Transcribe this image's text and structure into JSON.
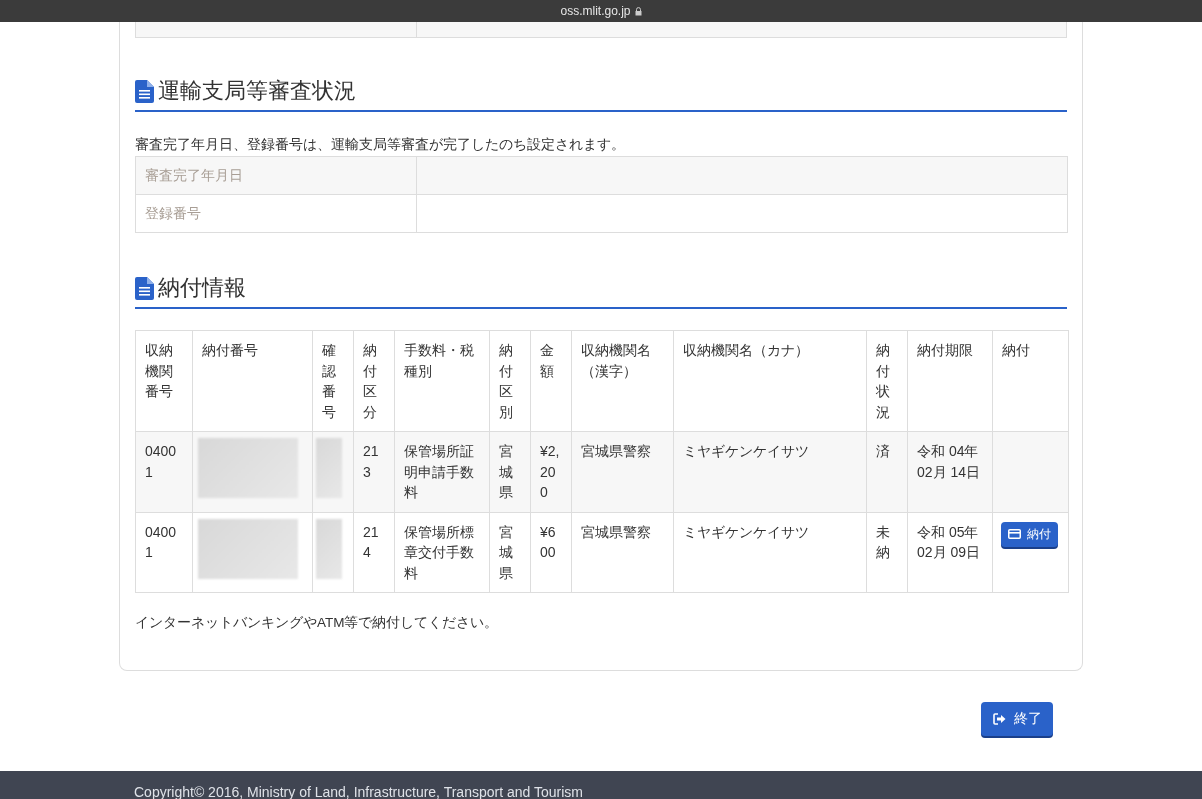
{
  "browser_bar": {
    "address": "oss.mlit.go.jp"
  },
  "review_section": {
    "title": "運輸支局等審査状況",
    "note": "審査完了年月日、登録番号は、運輸支局等審査が完了したのち設定されます。",
    "rows": [
      {
        "label": "審査完了年月日"
      },
      {
        "label": "登録番号"
      }
    ]
  },
  "payment_section": {
    "title": "納付情報",
    "columns": [
      "収納機関番号",
      "納付番号",
      "確認番号",
      "納付区分",
      "手数料・税種別",
      "納付区別",
      "金額",
      "収納機関名（漢字）",
      "収納機関名（カナ）",
      "納付状況",
      "納付期限",
      "納付"
    ],
    "rows": [
      {
        "agency_no": "04001",
        "payment_no": {
          "kind": "redacted"
        },
        "confirm_no": {
          "kind": "redacted"
        },
        "category": "213",
        "fee_type": "保管場所証明申請手数料",
        "division": "宮城県",
        "amount": "¥2,200",
        "agency_kanji": "宮城県警察",
        "agency_kana": "ミヤギケンケイサツ",
        "status": "済",
        "deadline": "令和 04年 02月 14日"
      },
      {
        "agency_no": "04001",
        "payment_no": {
          "kind": "redacted"
        },
        "confirm_no": {
          "kind": "redacted"
        },
        "category": "214",
        "fee_type": "保管場所標章交付手数料",
        "division": "宮城県",
        "amount": "¥600",
        "agency_kanji": "宮城県警察",
        "agency_kana": "ミヤギケンケイサツ",
        "status": "未納",
        "deadline": "令和 05年 02月 09日",
        "pay_button": "納付"
      }
    ],
    "note": "インターネットバンキングやATM等で納付してください。"
  },
  "finish_button": "終了",
  "footer": {
    "copyright": "Copyright© 2016, Ministry of Land, Infrastructure, Transport and Tourism"
  }
}
